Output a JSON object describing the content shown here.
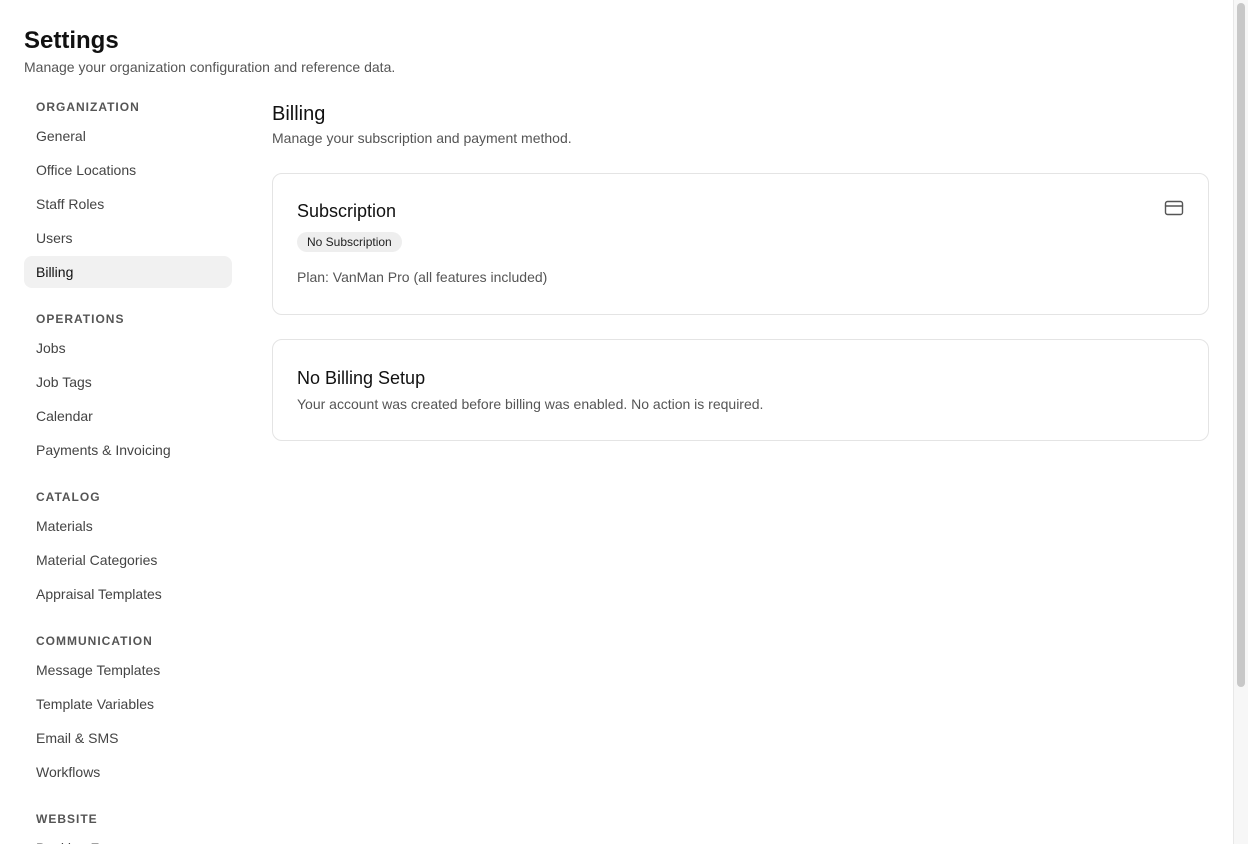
{
  "header": {
    "title": "Settings",
    "subtitle": "Manage your organization configuration and reference data."
  },
  "sidebar": {
    "sections": [
      {
        "label": "ORGANIZATION",
        "items": [
          "General",
          "Office Locations",
          "Staff Roles",
          "Users",
          "Billing"
        ]
      },
      {
        "label": "OPERATIONS",
        "items": [
          "Jobs",
          "Job Tags",
          "Calendar",
          "Payments & Invoicing"
        ]
      },
      {
        "label": "CATALOG",
        "items": [
          "Materials",
          "Material Categories",
          "Appraisal Templates"
        ]
      },
      {
        "label": "COMMUNICATION",
        "items": [
          "Message Templates",
          "Template Variables",
          "Email & SMS",
          "Workflows"
        ]
      },
      {
        "label": "WEBSITE",
        "items": [
          "Booking Form"
        ]
      }
    ],
    "active_item": "Billing"
  },
  "content": {
    "title": "Billing",
    "subtitle": "Manage your subscription and payment method.",
    "subscription_card": {
      "title": "Subscription",
      "badge": "No Subscription",
      "plan": "Plan: VanMan Pro (all features included)",
      "icon": "credit-card-icon"
    },
    "no_billing_card": {
      "title": "No Billing Setup",
      "description": "Your account was created before billing was enabled. No action is required."
    }
  },
  "colors": {
    "active_bg": "#f1f1f1",
    "badge_bg": "#eeeeee",
    "border": "#e4e4e4",
    "muted_text": "#555555"
  }
}
